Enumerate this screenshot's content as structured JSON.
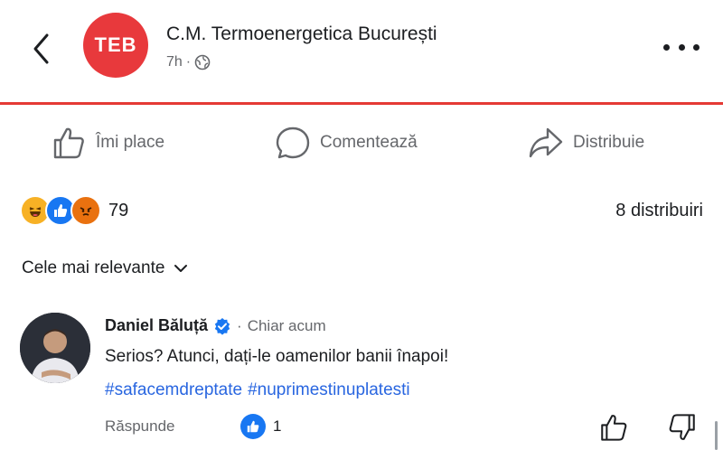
{
  "header": {
    "logo_text": "TEB",
    "page_name": "C.M. Termoenergetica București",
    "time": "7h",
    "separator": "·",
    "privacy_icon": "globe-icon"
  },
  "actions": {
    "like": "Îmi place",
    "comment": "Comentează",
    "share": "Distribuie"
  },
  "reactions": {
    "count": "79",
    "types": [
      "haha",
      "like",
      "angry"
    ],
    "shares": "8 distribuiri"
  },
  "filter": {
    "label": "Cele mai relevante"
  },
  "comment": {
    "author": "Daniel Băluță",
    "dot": "·",
    "time": "Chiar acum",
    "text": "Serios? Atunci, dați-le oamenilor banii înapoi!",
    "tags": [
      "#safacemdreptate",
      "#nuprimestinuplatesti"
    ],
    "reply": "Răspunde",
    "likes": "1"
  },
  "colors": {
    "accent_red": "#e53935",
    "like_blue": "#1877f2",
    "link_blue": "#2966e0",
    "muted": "#65676b"
  }
}
